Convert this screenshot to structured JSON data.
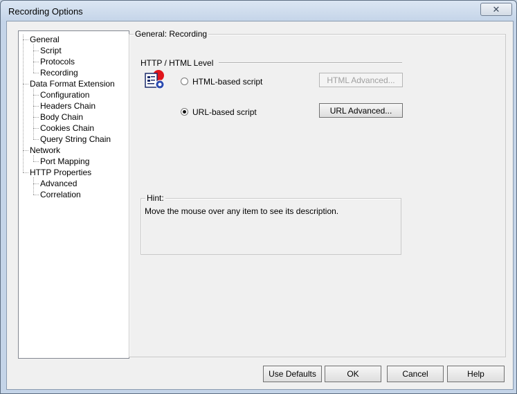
{
  "window": {
    "title": "Recording Options",
    "close_glyph": "✕"
  },
  "tree": [
    {
      "label": "General",
      "level": 0
    },
    {
      "label": "Script",
      "level": 1
    },
    {
      "label": "Protocols",
      "level": 1
    },
    {
      "label": "Recording",
      "level": 1
    },
    {
      "label": "Data Format Extension",
      "level": 0
    },
    {
      "label": "Configuration",
      "level": 1
    },
    {
      "label": "Headers Chain",
      "level": 1
    },
    {
      "label": "Body Chain",
      "level": 1
    },
    {
      "label": "Cookies Chain",
      "level": 1
    },
    {
      "label": "Query String Chain",
      "level": 1
    },
    {
      "label": "Network",
      "level": 0
    },
    {
      "label": "Port Mapping",
      "level": 1
    },
    {
      "label": "HTTP Properties",
      "level": 0
    },
    {
      "label": "Advanced",
      "level": 1
    },
    {
      "label": "Correlation",
      "level": 1
    }
  ],
  "panel": {
    "group_title": "General: Recording",
    "section_title": "HTTP / HTML Level",
    "options": [
      {
        "label": "HTML-based script",
        "checked": false,
        "button": "HTML Advanced...",
        "button_enabled": false
      },
      {
        "label": "URL-based script",
        "checked": true,
        "button": "URL Advanced...",
        "button_enabled": true
      }
    ],
    "hint_title": "Hint:",
    "hint_text": "Move the mouse over any item to see its description."
  },
  "buttons": {
    "use_defaults": "Use Defaults",
    "ok": "OK",
    "cancel": "Cancel",
    "help": "Help"
  },
  "icons": {
    "level_icon": "script-level-icon"
  }
}
